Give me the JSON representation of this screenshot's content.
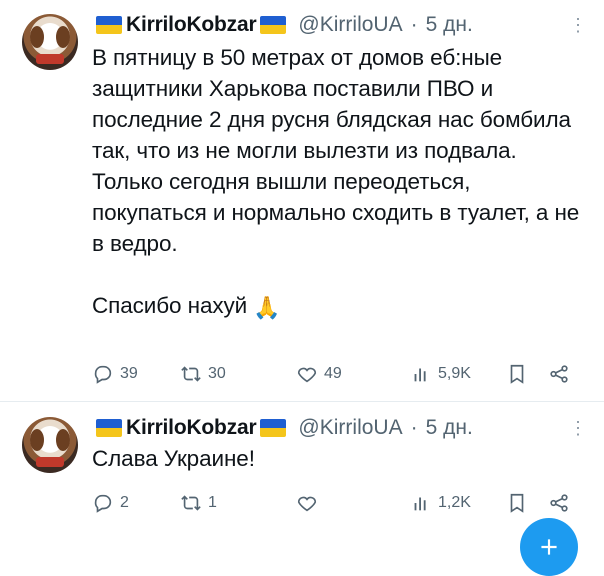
{
  "tweets": [
    {
      "author_name": "KirriloKobzar",
      "handle": "@KirriloUA",
      "separator": "·",
      "time": "5 дн.",
      "text": "В пятницу в 50 метрах от домов еб:​ные защитники Харькова поставили ПВО и последние 2 дня русня блядская нас бомбила так, что из не могли вылезти из подвала. Только сегодня вышли переодеться, покупаться и нормально сходить в туалет, а не в ведро.\n\nСпасибо нахуй",
      "emoji": "🙏",
      "replies": "39",
      "retweets": "30",
      "likes": "49",
      "views": "5,9K"
    },
    {
      "author_name": "KirriloKobzar",
      "handle": "@KirriloUA",
      "separator": "·",
      "time": "5 дн.",
      "text": "Слава Украине!",
      "replies": "2",
      "retweets": "1",
      "likes": "",
      "views": "1,2K"
    }
  ],
  "icons": {
    "more": "more-icon",
    "reply": "reply-icon",
    "retweet": "retweet-icon",
    "like": "heart-icon",
    "views": "views-icon",
    "bookmark": "bookmark-icon",
    "share": "share-icon",
    "compose": "compose-icon"
  },
  "colors": {
    "text": "#0f1419",
    "secondary": "#536471",
    "accent": "#1d9bf0",
    "flag_blue": "#1f5fd1",
    "flag_yellow": "#f4c51b"
  }
}
